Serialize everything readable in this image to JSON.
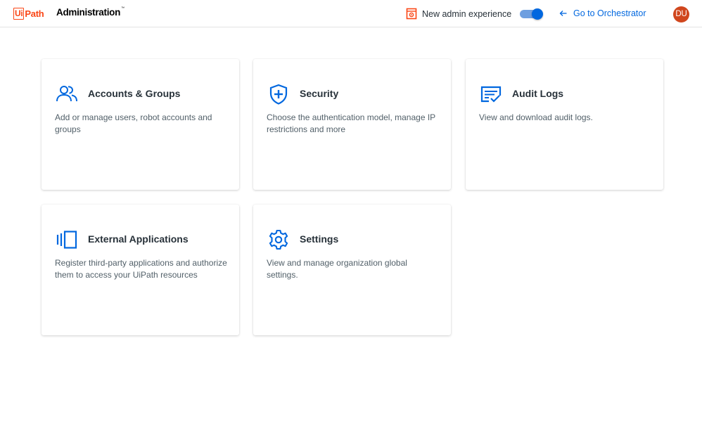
{
  "header": {
    "logo_box": "Ui",
    "logo_path": "Path",
    "title": "Administration",
    "title_mark": "™",
    "new_experience_label": "New admin experience",
    "new_experience_enabled": true,
    "goto_label": "Go to Orchestrator",
    "avatar_initials": "DU"
  },
  "colors": {
    "brand": "#fa4616",
    "accent": "#0067df",
    "avatar": "#d0461d",
    "icon": "#0067df"
  },
  "cards": [
    {
      "title": "Accounts & Groups",
      "description": "Add or manage users, robot accounts and groups",
      "icon": "people-icon"
    },
    {
      "title": "Security",
      "description": "Choose the authentication model, manage IP restrictions and more",
      "icon": "shield-plus-icon"
    },
    {
      "title": "Audit Logs",
      "description": "View and download audit logs.",
      "icon": "audit-log-icon"
    },
    {
      "title": "External Applications",
      "description": "Register third-party applications and authorize them to access your UiPath resources",
      "icon": "external-app-icon"
    },
    {
      "title": "Settings",
      "description": "View and manage organization global settings.",
      "icon": "gear-icon"
    }
  ]
}
